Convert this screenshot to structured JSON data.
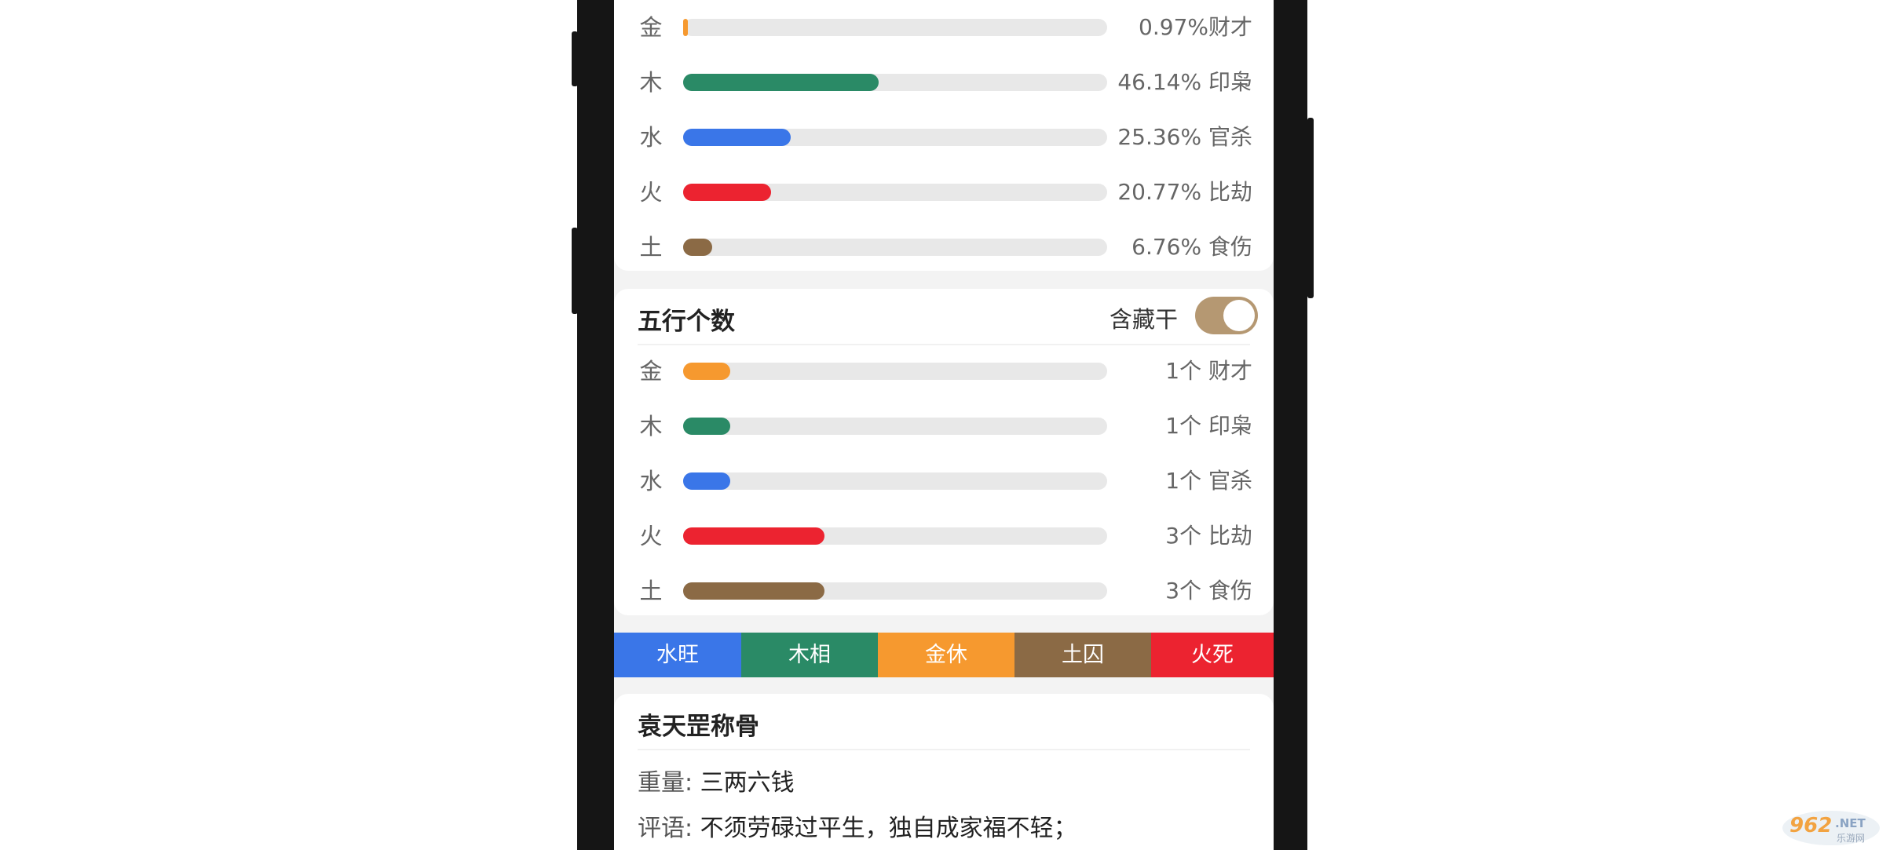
{
  "colors": {
    "metal": "#f6992f",
    "wood": "#2a8a66",
    "water": "#3a76e8",
    "fire": "#ec2330",
    "earth": "#8b6a45",
    "toggle": "#b59872"
  },
  "strength": {
    "rows": [
      {
        "element": "金",
        "value": "0.97%财才",
        "fraction": 0.0097
      },
      {
        "element": "木",
        "value": "46.14% 印枭",
        "fraction": 0.4614
      },
      {
        "element": "水",
        "value": "25.36% 官杀",
        "fraction": 0.2536
      },
      {
        "element": "火",
        "value": "20.77% 比劫",
        "fraction": 0.2077
      },
      {
        "element": "土",
        "value": "6.76% 食伤",
        "fraction": 0.0676
      }
    ]
  },
  "count": {
    "title": "五行个数",
    "toggle_label": "含藏干",
    "toggle_on": true,
    "rows": [
      {
        "element": "金",
        "value": "1个 财才",
        "count": 1
      },
      {
        "element": "木",
        "value": "1个 印枭",
        "count": 1
      },
      {
        "element": "水",
        "value": "1个 官杀",
        "count": 1
      },
      {
        "element": "火",
        "value": "3个 比劫",
        "count": 3
      },
      {
        "element": "土",
        "value": "3个 食伤",
        "count": 3
      }
    ]
  },
  "seasons": [
    {
      "label": "水旺",
      "color": "#3a76e8"
    },
    {
      "label": "木相",
      "color": "#2a8a66"
    },
    {
      "label": "金休",
      "color": "#f6992f"
    },
    {
      "label": "土囚",
      "color": "#8b6a45"
    },
    {
      "label": "火死",
      "color": "#ec2330"
    }
  ],
  "bone": {
    "title": "袁天罡称骨",
    "weight_label": "重量:",
    "weight_value": "三两六钱",
    "comment_label": "评语:",
    "comment_value": "不须劳碌过平生，独自成家福不轻；"
  },
  "watermark": "962.NET 乐游网"
}
